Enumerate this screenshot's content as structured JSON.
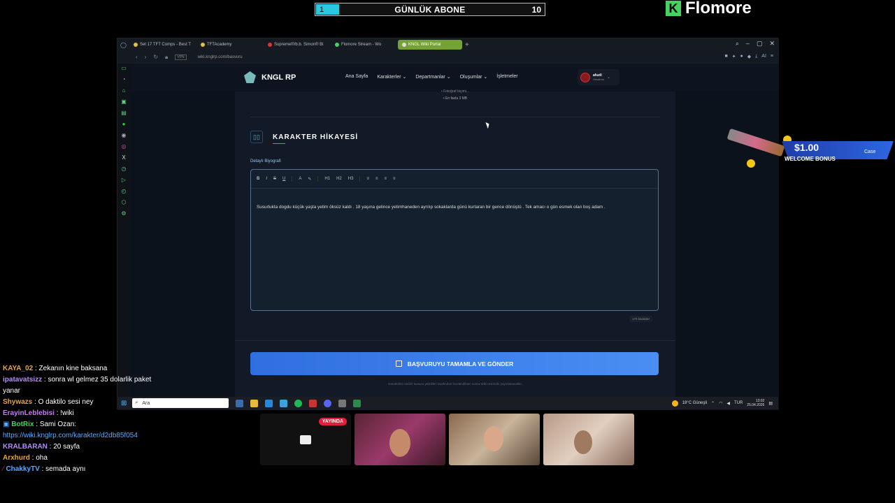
{
  "stream": {
    "goal": {
      "title": "GÜNLÜK ABONE",
      "current": "1",
      "target": "10",
      "progress": 0.1
    },
    "brand": "Flomore",
    "live_badge": "YAYINDA"
  },
  "browser": {
    "tabs": [
      {
        "label": "Set 17 TFT Comps - Best T",
        "active": false
      },
      {
        "label": "TFTAcademy",
        "active": false
      },
      {
        "label": "Supreme®/b.b. Simon® Bi",
        "active": false
      },
      {
        "label": "Flomore Stream - Wo",
        "active": false
      },
      {
        "label": "KNGL Wiki Portal",
        "active": true
      }
    ],
    "vpn": "VPN",
    "url": "wiki.knglrp.com/basvuru"
  },
  "site": {
    "logo": "KNGL RP",
    "nav": [
      {
        "label": "Ana Sayfa"
      },
      {
        "label": "Karakterler ⌄"
      },
      {
        "label": "Departmanlar ⌄"
      },
      {
        "label": "Oluşumlar ⌄"
      },
      {
        "label": "İşletmeler"
      }
    ],
    "user": {
      "name": "afuzli",
      "role": "Hesabım"
    },
    "upload_note_1": "• Fotoğraf biçimi...",
    "upload_note_2": "• En fazla 3 MB",
    "section_title": "KARAKTER HİKAYESİ",
    "field_label": "Detaylı Biyografi",
    "toolbar": [
      "B",
      "I",
      "S",
      "U",
      "A",
      "✎",
      "H1",
      "H2",
      "H3",
      "≡",
      "≡",
      "≡",
      "≡"
    ],
    "biography": "Susurlukta dogdu küçük yaşta yetim öksüz kaldı . 18 yaşına gelince yetimhaneden ayrılıp sokaklarda günü kurtaran bir gence dönüştü . Tek amacı o gün esmek olan boş adam .",
    "char_count": "170 karakter",
    "submit_label": "BAŞVURUYU TAMAMLA VE GÖNDER",
    "footnote": "Gönderilen veriler sunucu yetkilileri tarafından incelendikten sonra Wiki üzerinde yayınlanacaktır."
  },
  "taskbar": {
    "search_placeholder": "Ara",
    "weather": "18°C Güneşli",
    "lang": "TUR",
    "time": "13:02",
    "date": "25.04.2026"
  },
  "chat": [
    {
      "user": "KAYA_02",
      "color": "#e8a53a",
      "text": "Zekanın kine baksana"
    },
    {
      "user": "ipatavatsizz",
      "color": "#b48cff",
      "text": "sonra wl gelmez 35 dolarlik paket yanar"
    },
    {
      "user": "Shywazs",
      "color": "#e8a53a",
      "text": "O daktilo sesi ney"
    },
    {
      "user": "ErayinLeblebisi",
      "color": "#c879ff",
      "text": "!wiki"
    },
    {
      "user": "BotRix",
      "color": "#46d160",
      "text": "Sami Ozan:",
      "link": "https://wiki.knglrp.com/karakter/d2db85f054"
    },
    {
      "user": "KRALBARAN",
      "color": "#b48cff",
      "text": "20 sayfa"
    },
    {
      "user": "Arxhurd",
      "color": "#e8a53a",
      "text": "oha"
    },
    {
      "user": "ChakkyTV",
      "color": "#5aa9ff",
      "text": "semada aynı"
    }
  ],
  "ad": {
    "price": "$1.00",
    "label": "WELCOME BONUS",
    "brand": "Case"
  },
  "colors": {
    "accent": "#3a7ae6",
    "tab_active": "#74a233",
    "goal_fill": "#29c7e0"
  }
}
